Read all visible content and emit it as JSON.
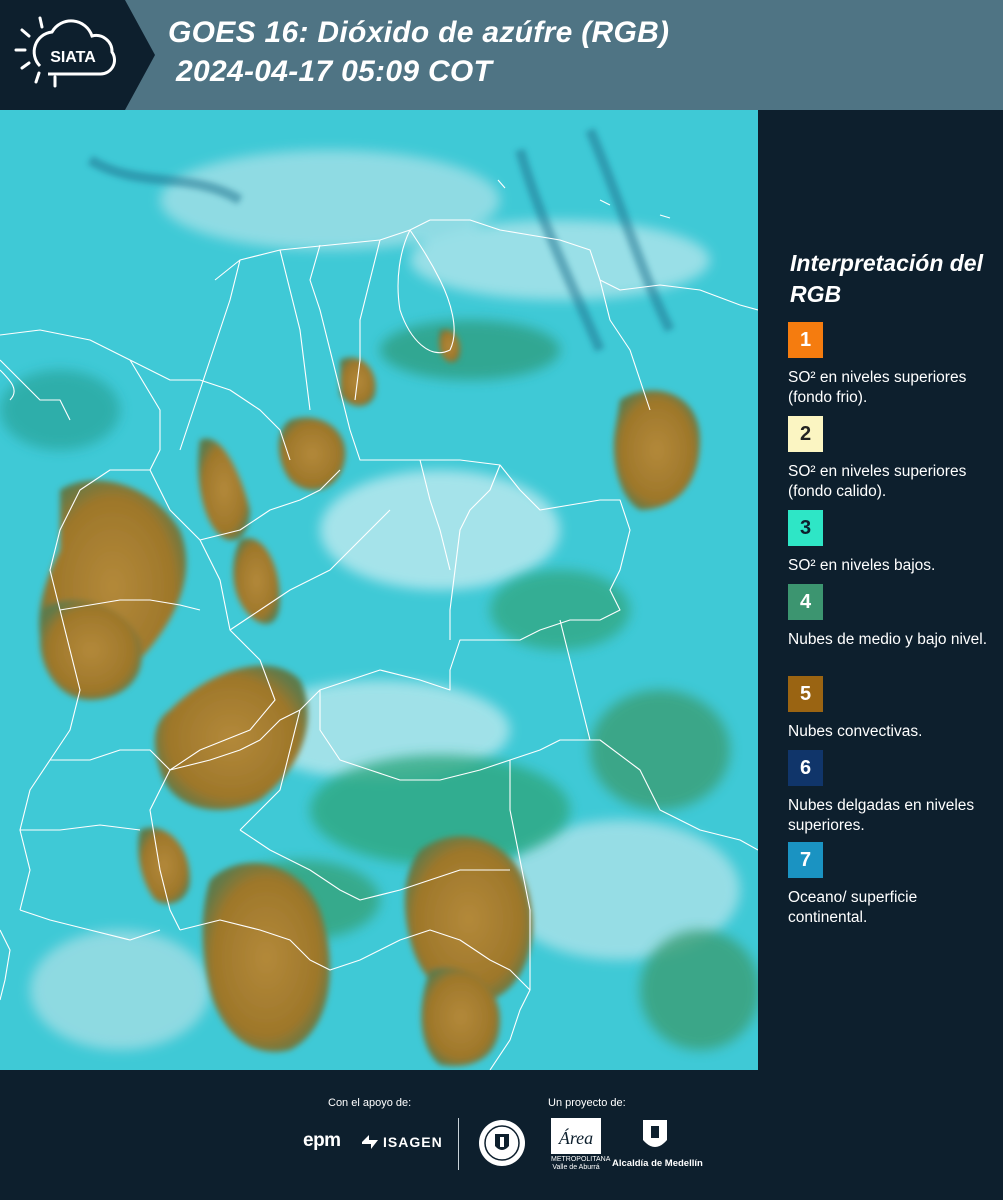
{
  "header": {
    "logo_text": "SIATA",
    "title_line1": "GOES 16: Dióxido de azúfre (RGB)",
    "title_line2": "2024-04-17 05:09 COT"
  },
  "colors": {
    "header_bg": "#4f7484",
    "panel_bg": "#0d1f2d",
    "map_base": "#3ec9d6",
    "convective": "#a87d2a",
    "boundaries": "#ffffff"
  },
  "legend": {
    "title": "Interpretación del RGB",
    "items": [
      {
        "number": "1",
        "color": "#f57c0f",
        "label": "SO² en niveles superiores (fondo frio)."
      },
      {
        "number": "2",
        "color": "#fbf5c2",
        "label": "SO² en niveles superiores (fondo calido)."
      },
      {
        "number": "3",
        "color": "#2ee6c6",
        "label": "SO² en niveles bajos."
      },
      {
        "number": "4",
        "color": "#3c9570",
        "label": "Nubes de medio y bajo nivel."
      },
      {
        "number": "5",
        "color": "#9a6412",
        "label": "Nubes convectivas."
      },
      {
        "number": "6",
        "color": "#10356a",
        "label": "Nubes delgadas en niveles superiores."
      },
      {
        "number": "7",
        "color": "#1a93c2",
        "label": "Oceano/ superficie continental."
      }
    ]
  },
  "footer": {
    "support_caption": "Con el apoyo de:",
    "project_caption": "Un proyecto de:",
    "sponsors": [
      "epm",
      "ISAGEN"
    ],
    "area_logo_text": "Área",
    "area_caption": "METROPOLITANA Valle de Aburrá",
    "alcaldia_label": "Alcaldía de Medellín"
  }
}
